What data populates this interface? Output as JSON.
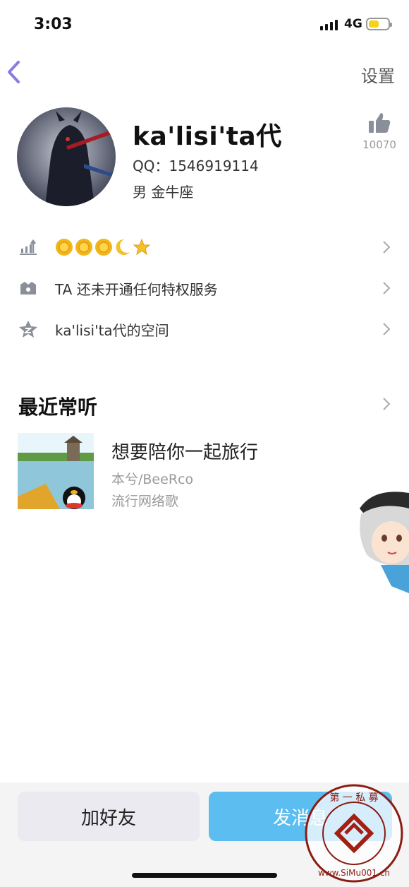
{
  "status_bar": {
    "time": "3:03",
    "network": "4G"
  },
  "nav": {
    "settings_label": "设置"
  },
  "profile": {
    "nickname": "ka'lisi'ta代",
    "qq": "QQ：1546919114",
    "gender_constellation": "男  金牛座",
    "like_count": "10070"
  },
  "rows": {
    "privilege_text": "TA 还未开通任何特权服务",
    "space_text": "ka'lisi'ta代的空间"
  },
  "recent": {
    "title": "最近常听",
    "song_title": "想要陪你一起旅行",
    "song_artist": "本兮/BeeRco",
    "song_tag": "流行网络歌"
  },
  "actions": {
    "add_friend": "加好友",
    "send_message": "发消息"
  },
  "watermark": {
    "text": "第一私募 www.SiMu001.cn"
  },
  "colors": {
    "accent": "#5bbdf0",
    "back_arrow": "#8a7be0"
  }
}
